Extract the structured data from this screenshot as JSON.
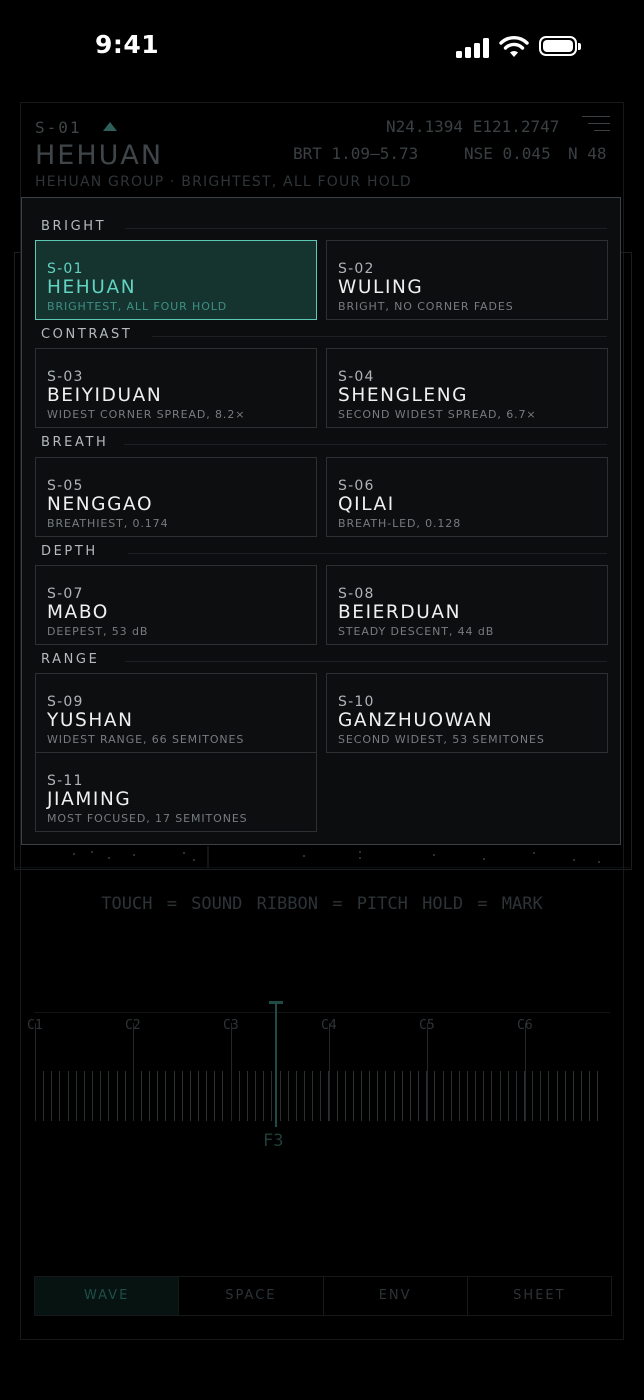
{
  "status": {
    "time": "9:41"
  },
  "header": {
    "site_id": "S-01",
    "coords": "N24.1394 E121.2747",
    "title": "HEHUAN",
    "brt": "BRT 1.09–5.73",
    "nse": "NSE 0.045",
    "n": "N 48",
    "subtitle": "HEHUAN GROUP · BRIGHTEST, ALL FOUR HOLD"
  },
  "hint": "TOUCH = SOUND   RIBBON = PITCH   HOLD = MARK",
  "keyboard": {
    "octaves": [
      "C1",
      "C2",
      "C3",
      "C4",
      "C5",
      "C6"
    ],
    "marker_note": "F3"
  },
  "tabs": [
    {
      "label": "WAVE",
      "active": true
    },
    {
      "label": "SPACE",
      "active": false
    },
    {
      "label": "ENV",
      "active": false
    },
    {
      "label": "SHEET",
      "active": false
    }
  ],
  "picker": {
    "sections": [
      {
        "label": "BRIGHT",
        "sites": [
          {
            "id": "S-01",
            "name": "HEHUAN",
            "desc": "BRIGHTEST, ALL FOUR HOLD",
            "selected": true
          },
          {
            "id": "S-02",
            "name": "WULING",
            "desc": "BRIGHT, NO CORNER FADES",
            "selected": false
          }
        ]
      },
      {
        "label": "CONTRAST",
        "sites": [
          {
            "id": "S-03",
            "name": "BEIYIDUAN",
            "desc": "WIDEST CORNER SPREAD, 8.2×",
            "selected": false
          },
          {
            "id": "S-04",
            "name": "SHENGLENG",
            "desc": "SECOND WIDEST SPREAD, 6.7×",
            "selected": false
          }
        ]
      },
      {
        "label": "BREATH",
        "sites": [
          {
            "id": "S-05",
            "name": "NENGGAO",
            "desc": "BREATHIEST, 0.174",
            "selected": false
          },
          {
            "id": "S-06",
            "name": "QILAI",
            "desc": "BREATH-LED, 0.128",
            "selected": false
          }
        ]
      },
      {
        "label": "DEPTH",
        "sites": [
          {
            "id": "S-07",
            "name": "MABO",
            "desc": "DEEPEST, 53 dB",
            "selected": false
          },
          {
            "id": "S-08",
            "name": "BEIERDUAN",
            "desc": "STEADY DESCENT, 44 dB",
            "selected": false
          }
        ]
      },
      {
        "label": "RANGE",
        "sites": [
          {
            "id": "S-09",
            "name": "YUSHAN",
            "desc": "WIDEST RANGE, 66 SEMITONES",
            "selected": false
          },
          {
            "id": "S-10",
            "name": "GANZHUOWAN",
            "desc": "SECOND WIDEST, 53 SEMITONES",
            "selected": false
          },
          {
            "id": "S-11",
            "name": "JIAMING",
            "desc": "MOST FOCUSED, 17 SEMITONES",
            "selected": false
          }
        ]
      }
    ]
  }
}
